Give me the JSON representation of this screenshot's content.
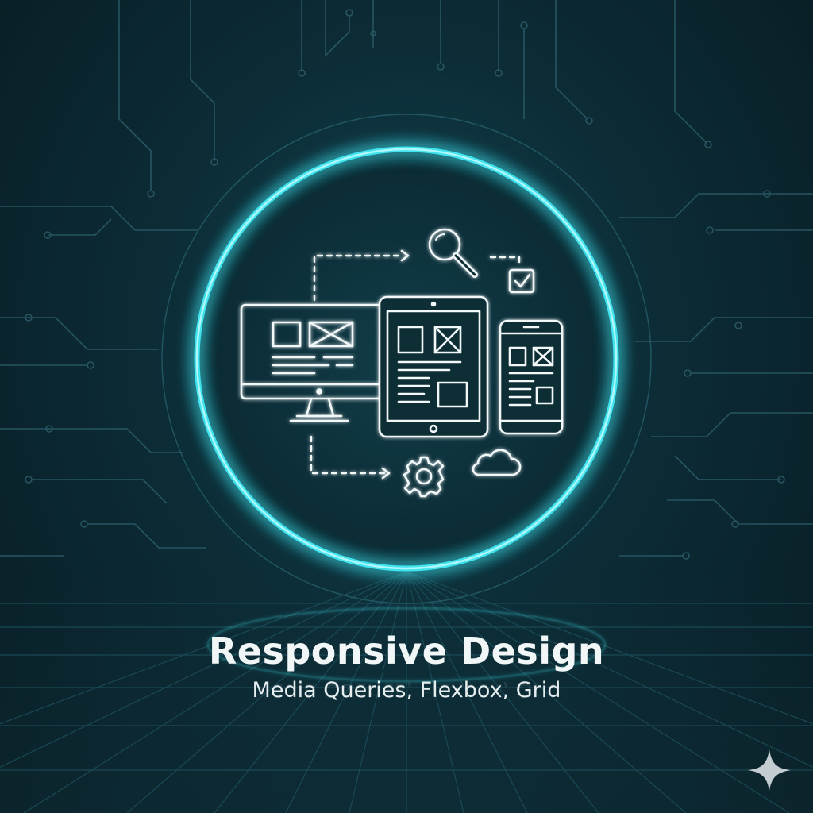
{
  "headline": {
    "title": "Responsive Design",
    "subtitle": "Media Queries, Flexbox, Grid"
  },
  "icons": {
    "center": [
      "desktop-monitor-icon",
      "tablet-icon",
      "smartphone-icon"
    ],
    "around": [
      "magnifier-icon",
      "checkbox-icon",
      "gear-icon",
      "cloud-icon"
    ],
    "corner": "sparkle-icon"
  },
  "colors": {
    "background": "#0a1f27",
    "glow": "#3fe3ee",
    "line": "#f2f7f8",
    "circuit": "#2a5a66"
  }
}
